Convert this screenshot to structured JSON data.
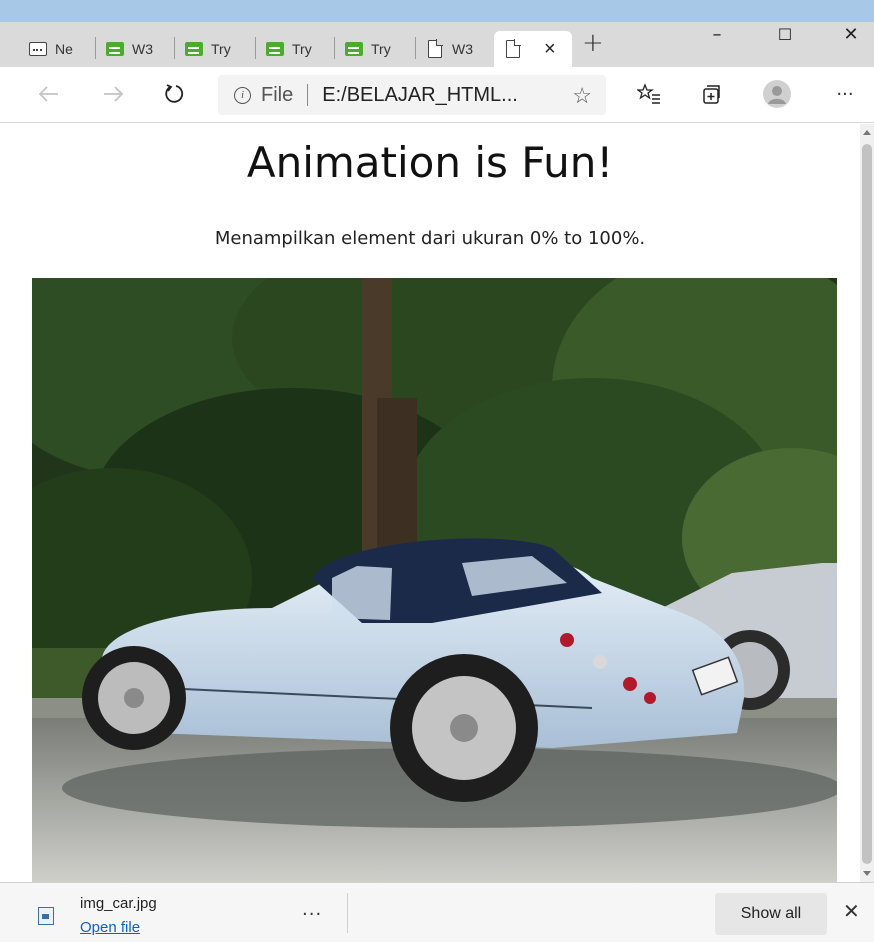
{
  "browser": {
    "tabs": [
      {
        "label": "Ne",
        "icon": "new-tab-page-icon"
      },
      {
        "label": "W3",
        "icon": "w3schools-icon"
      },
      {
        "label": "Try",
        "icon": "w3schools-icon"
      },
      {
        "label": "Try",
        "icon": "w3schools-icon"
      },
      {
        "label": "Try",
        "icon": "w3schools-icon"
      },
      {
        "label": "W3",
        "icon": "page-icon"
      },
      {
        "label": "",
        "icon": "page-icon",
        "active": true
      }
    ],
    "active_tab_close": "×",
    "new_tab": "+",
    "window_controls": {
      "minimize": "–",
      "maximize": "☐",
      "close": "✕"
    },
    "address": {
      "scheme": "File",
      "url": "E:/BELAJAR_HTML..."
    },
    "toolbar_icons": [
      "back-icon",
      "forward-icon",
      "refresh-icon",
      "favorites-icon",
      "collections-icon",
      "profile-icon",
      "more-icon"
    ]
  },
  "page": {
    "title": "Animation is Fun!",
    "description": "Menampilkan element dari ukuran 0% to 100%."
  },
  "download": {
    "file_name": "img_car.jpg",
    "open_label": "Open file",
    "more": "...",
    "show_all": "Show all",
    "close": "✕"
  },
  "colors": {
    "accent": "#a8c8e8",
    "tabstrip": "#dadada",
    "w3_green": "#4caa2e",
    "link": "#0b63c4"
  }
}
